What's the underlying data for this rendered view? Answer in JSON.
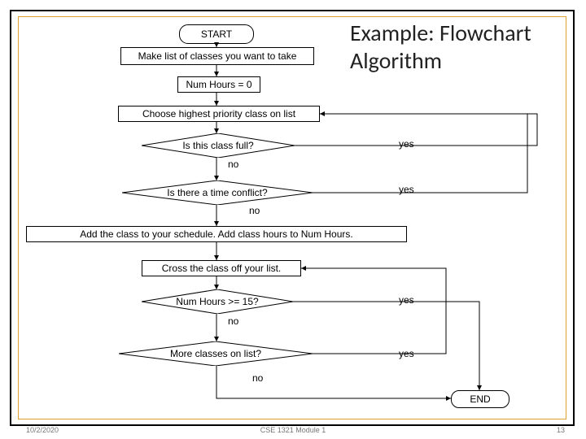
{
  "title": "Example: Flowchart Algorithm",
  "footer": {
    "date": "10/2/2020",
    "center": "CSE 1321 Module 1",
    "page": "13"
  },
  "nodes": {
    "start": "START",
    "makelist": "Make list of classes you want to take",
    "numhours": "Num Hours = 0",
    "choose": "Choose highest priority class on list",
    "isfull": "Is this class full?",
    "conflict": "Is there a time conflict?",
    "addclass": "Add the class to your schedule. Add class hours to Num Hours.",
    "cross": "Cross the class off your list.",
    "ge15": "Num Hours >= 15?",
    "more": "More classes on list?",
    "end": "END"
  },
  "labels": {
    "yes1": "yes",
    "yes2": "yes",
    "yes3": "yes",
    "yes4": "yes",
    "no1": "no",
    "no2": "no",
    "no3": "no",
    "no4": "no"
  }
}
